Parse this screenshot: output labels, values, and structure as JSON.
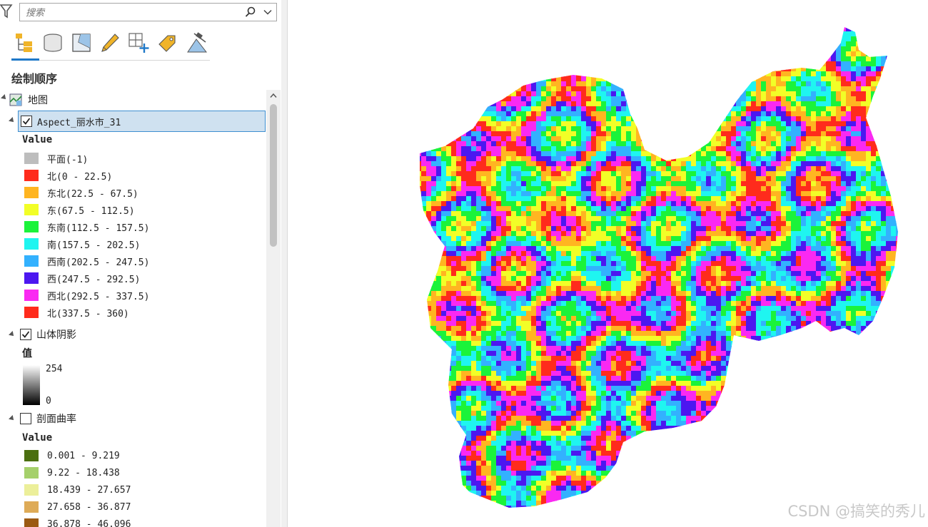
{
  "search": {
    "placeholder": "搜索"
  },
  "toolbar": {
    "icons": [
      "drawing-order-icon",
      "data-source-icon",
      "selection-icon",
      "editing-icon",
      "snapping-icon",
      "labeling-icon",
      "charts-icon"
    ]
  },
  "section": {
    "title": "绘制顺序"
  },
  "tree": {
    "map_label": "地图",
    "layers": [
      {
        "name": "Aspect_丽水市_31",
        "checked": true,
        "selected": true,
        "legend_title": "Value",
        "classes": [
          {
            "label": "平面(-1)",
            "color": "#bdbdbd"
          },
          {
            "label": "北(0 - 22.5)",
            "color": "#ff2b1c"
          },
          {
            "label": "东北(22.5 - 67.5)",
            "color": "#ffb521"
          },
          {
            "label": "东(67.5 - 112.5)",
            "color": "#f2fe27"
          },
          {
            "label": "东南(112.5 - 157.5)",
            "color": "#1bf33a"
          },
          {
            "label": "南(157.5 - 202.5)",
            "color": "#1ff5f0"
          },
          {
            "label": "西南(202.5 - 247.5)",
            "color": "#33b1fe"
          },
          {
            "label": "西(247.5 - 292.5)",
            "color": "#4c17f0"
          },
          {
            "label": "西北(292.5 - 337.5)",
            "color": "#fa29f2"
          },
          {
            "label": "北(337.5 - 360)",
            "color": "#ff2b1c"
          }
        ]
      },
      {
        "name": "山体阴影",
        "checked": true,
        "legend_title": "值",
        "ramp_max": "254",
        "ramp_min": "0"
      },
      {
        "name": "剖面曲率",
        "checked": false,
        "legend_title": "Value",
        "classes": [
          {
            "label": "0.001 - 9.219",
            "color": "#4b6f10"
          },
          {
            "label": "9.22 - 18.438",
            "color": "#a5d06b"
          },
          {
            "label": "18.439 - 27.657",
            "color": "#ecef9a"
          },
          {
            "label": "27.658 - 36.877",
            "color": "#deab57"
          },
          {
            "label": "36.878 - 46.096",
            "color": "#9b5a12"
          }
        ]
      }
    ]
  },
  "map": {
    "aspect_palette": [
      "#ff2b1c",
      "#ffb521",
      "#f2fe27",
      "#1bf33a",
      "#1ff5f0",
      "#33b1fe",
      "#4c17f0",
      "#fa29f2"
    ]
  },
  "watermark": "CSDN @搞笑的秀儿"
}
